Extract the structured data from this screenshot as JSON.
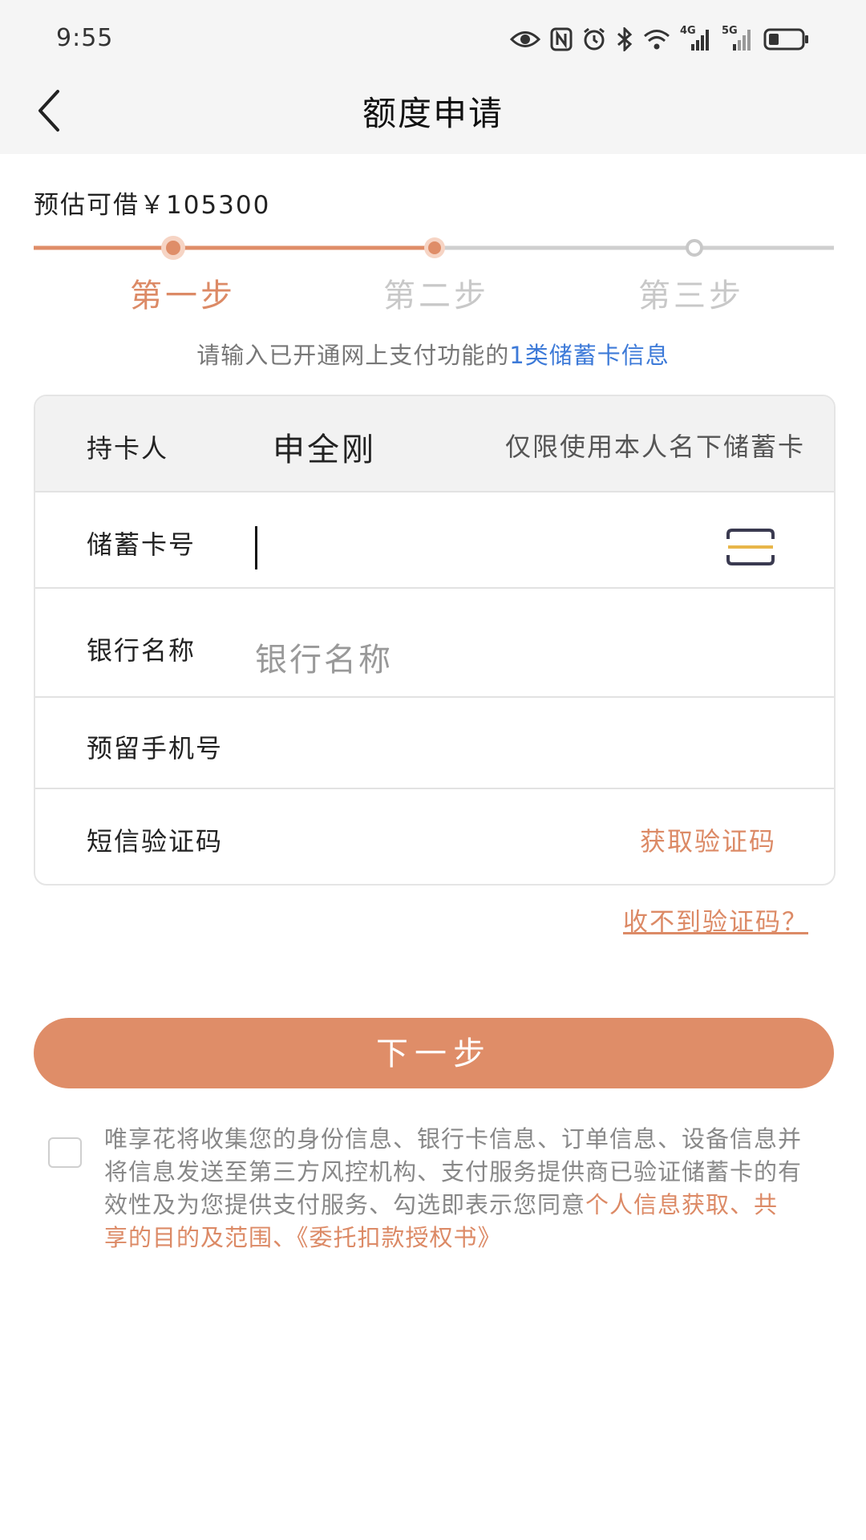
{
  "status_bar": {
    "time": "9:55",
    "network_1": "4G",
    "network_2": "5G"
  },
  "header": {
    "title": "额度申请"
  },
  "estimate": {
    "label": "预估可借￥105300"
  },
  "steps": [
    {
      "label": "第一步",
      "state": "active"
    },
    {
      "label": "第二步",
      "state": "inactive"
    },
    {
      "label": "第三步",
      "state": "inactive"
    }
  ],
  "hint": {
    "prefix": "请输入已开通网上支付功能的",
    "highlight": "1类储蓄卡信息"
  },
  "form": {
    "holder_label": "持卡人",
    "holder_name": "申全刚",
    "holder_note": "仅限使用本人名下储蓄卡",
    "card_label": "储蓄卡号",
    "card_value": "",
    "bank_label": "银行名称",
    "bank_placeholder": "银行名称",
    "phone_label": "预留手机号",
    "code_label": "短信验证码",
    "get_code": "获取验证码"
  },
  "no_code_link": "收不到验证码？",
  "next_button": "下一步",
  "agreement": {
    "text": "唯享花将收集您的身份信息、银行卡信息、订单信息、设备信息并将信息发送至第三方风控机构、支付服务提供商已验证储蓄卡的有效性及为您提供支付服务、勾选即表示您同意",
    "link1": "个人信息获取、共享的目的及范围、",
    "link2": "《委托扣款授权书》"
  },
  "colors": {
    "accent": "#df8d68",
    "link_blue": "#3d7ad8",
    "inactive": "#c8c8c8"
  }
}
